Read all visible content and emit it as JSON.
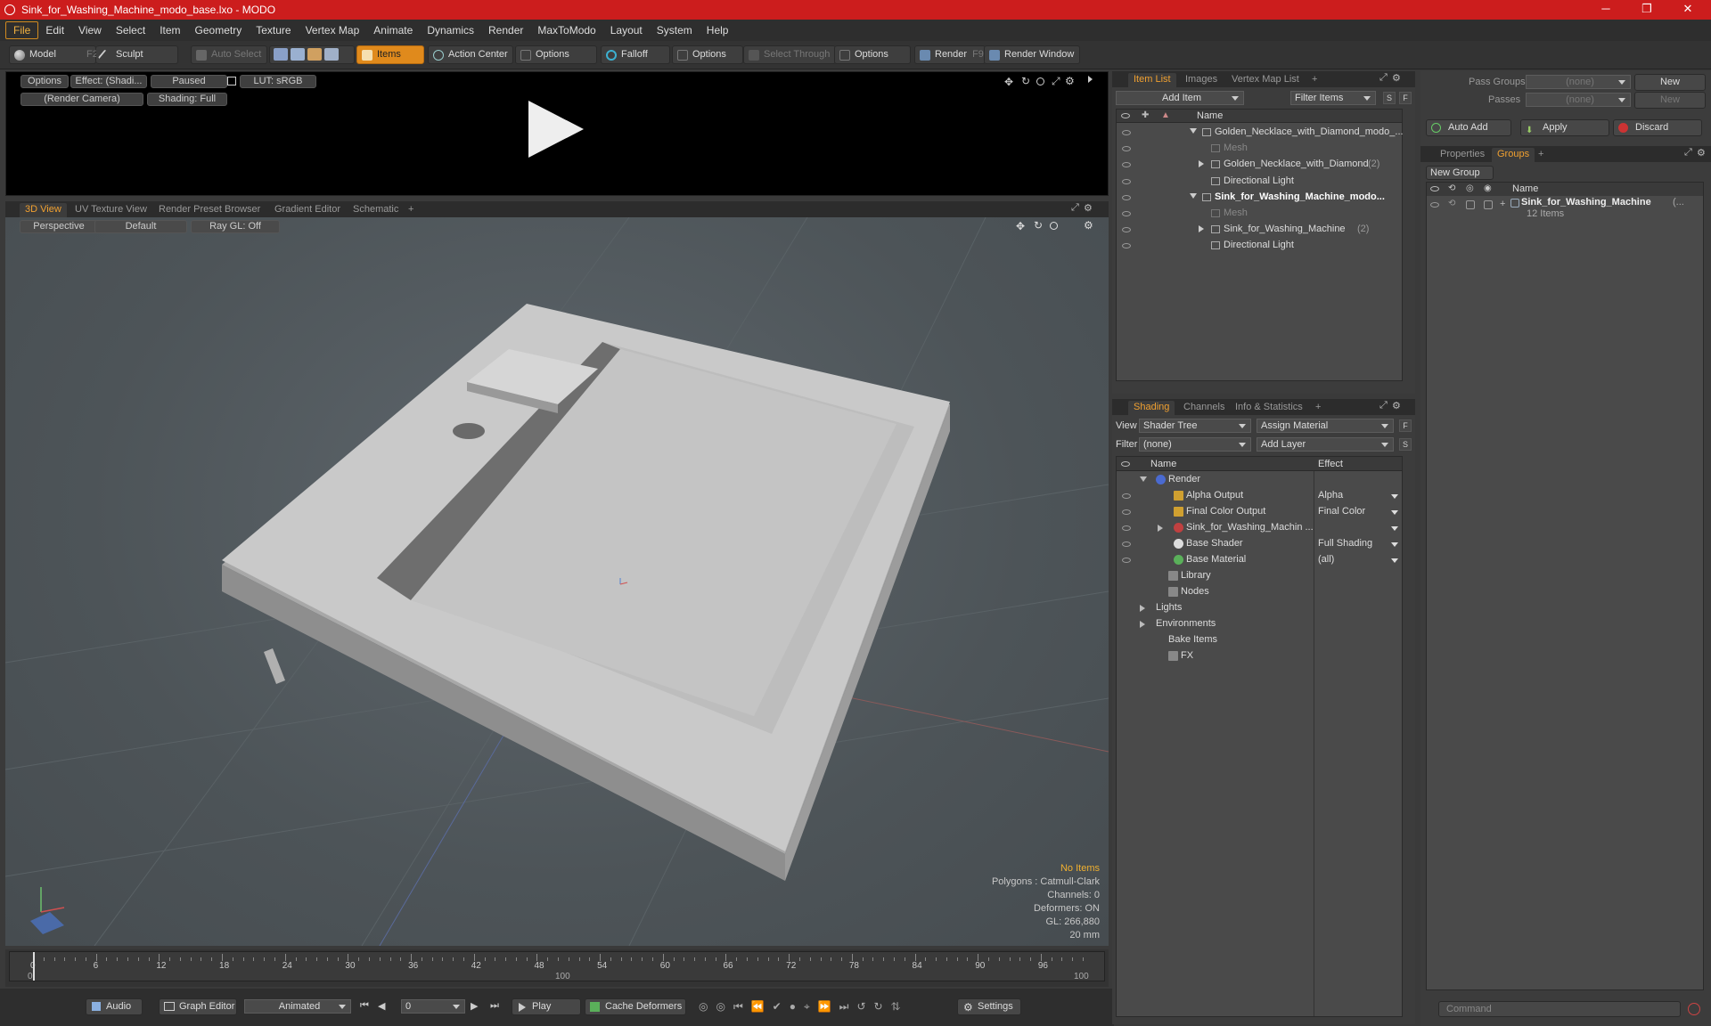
{
  "window": {
    "title": "Sink_for_Washing_Machine_modo_base.lxo - MODO",
    "minimize": "─",
    "maximize": "❐",
    "close": "✕"
  },
  "menu": [
    "File",
    "Edit",
    "View",
    "Select",
    "Item",
    "Geometry",
    "Texture",
    "Vertex Map",
    "Animate",
    "Dynamics",
    "Render",
    "MaxToModo",
    "Layout",
    "System",
    "Help"
  ],
  "toolbar": {
    "model": "Model",
    "model_key": "F2",
    "sculpt": "Sculpt",
    "auto_select": "Auto Select",
    "items": "Items",
    "action_center": "Action Center",
    "options1": "Options",
    "falloff": "Falloff",
    "options2": "Options",
    "select_through": "Select Through",
    "options3": "Options",
    "render": "Render",
    "render_key": "F9",
    "render_window": "Render Window"
  },
  "preview": {
    "options": "Options",
    "effect": "Effect: (Shadi...",
    "paused": "Paused",
    "lut": "LUT: sRGB",
    "camera": "(Render Camera)",
    "shading": "Shading: Full"
  },
  "viewport_tabs": [
    "3D View",
    "UV Texture View",
    "Render Preset Browser",
    "Gradient Editor",
    "Schematic",
    "+"
  ],
  "viewport": {
    "perspective": "Perspective",
    "default": "Default",
    "raygl": "Ray GL: Off",
    "info": {
      "no_items": "No Items",
      "polygons": "Polygons : Catmull-Clark",
      "channels": "Channels: 0",
      "deformers": "Deformers: ON",
      "gl": "GL: 266,880",
      "unit": "20 mm"
    }
  },
  "timeline": {
    "ticks": [
      "0",
      "6",
      "12",
      "18",
      "24",
      "30",
      "36",
      "42",
      "48",
      "54",
      "60",
      "66",
      "72",
      "78",
      "84",
      "90",
      "96"
    ],
    "start": "0",
    "end": "100",
    "mid": "100"
  },
  "bottombar": {
    "audio": "Audio",
    "graph_editor": "Graph Editor",
    "animated": "Animated",
    "frame": "0",
    "play": "Play",
    "cache": "Cache Deformers",
    "settings": "Settings"
  },
  "itemlist": {
    "tabs": [
      "Item List",
      "Images",
      "Vertex Map List",
      "+"
    ],
    "add_item": "Add Item",
    "filter": "Filter Items",
    "s": "S",
    "f": "F",
    "col_name": "Name",
    "rows": [
      {
        "label": "Golden_Necklace_with_Diamond_modo_...",
        "indent": 0,
        "bold": false,
        "dim": false
      },
      {
        "label": "Mesh",
        "indent": 1,
        "bold": false,
        "dim": true
      },
      {
        "label": "Golden_Necklace_with_Diamond",
        "count": "(2)",
        "indent": 1,
        "bold": false,
        "dim": false
      },
      {
        "label": "Directional Light",
        "indent": 1,
        "bold": false,
        "dim": false
      },
      {
        "label": "Sink_for_Washing_Machine_modo...",
        "indent": 0,
        "bold": true,
        "dim": false
      },
      {
        "label": "Mesh",
        "indent": 1,
        "bold": false,
        "dim": true
      },
      {
        "label": "Sink_for_Washing_Machine",
        "count": "(2)",
        "indent": 1,
        "bold": false,
        "dim": false
      },
      {
        "label": "Directional Light",
        "indent": 1,
        "bold": false,
        "dim": false
      }
    ]
  },
  "shading": {
    "tabs": [
      "Shading",
      "Channels",
      "Info & Statistics",
      "+"
    ],
    "view_label": "View",
    "view_value": "Shader Tree",
    "assign": "Assign Material",
    "filter_label": "Filter",
    "filter_value": "(none)",
    "add_layer": "Add Layer",
    "f": "F",
    "s": "S",
    "col_name": "Name",
    "col_effect": "Effect",
    "rows": [
      {
        "name": "Render",
        "effect": ""
      },
      {
        "name": "Alpha Output",
        "effect": "Alpha"
      },
      {
        "name": "Final Color Output",
        "effect": "Final Color"
      },
      {
        "name": "Sink_for_Washing_Machin ...",
        "effect": ""
      },
      {
        "name": "Base Shader",
        "effect": "Full Shading"
      },
      {
        "name": "Base Material",
        "effect": "(all)"
      },
      {
        "name": "Library",
        "effect": ""
      },
      {
        "name": "Nodes",
        "effect": ""
      },
      {
        "name": "Lights",
        "effect": ""
      },
      {
        "name": "Environments",
        "effect": ""
      },
      {
        "name": "Bake Items",
        "effect": ""
      },
      {
        "name": "FX",
        "effect": ""
      }
    ]
  },
  "right": {
    "pass_groups": "Pass Groups",
    "passes": "Passes",
    "none": "(none)",
    "new": "New",
    "auto_add": "Auto Add",
    "apply": "Apply",
    "discard": "Discard",
    "tabs": [
      "Properties",
      "Groups",
      "+"
    ],
    "new_group": "New Group",
    "col_name": "Name",
    "group_name": "Sink_for_Washing_Machine",
    "group_suffix": "(...",
    "group_items": "12 Items",
    "command": "Command"
  }
}
